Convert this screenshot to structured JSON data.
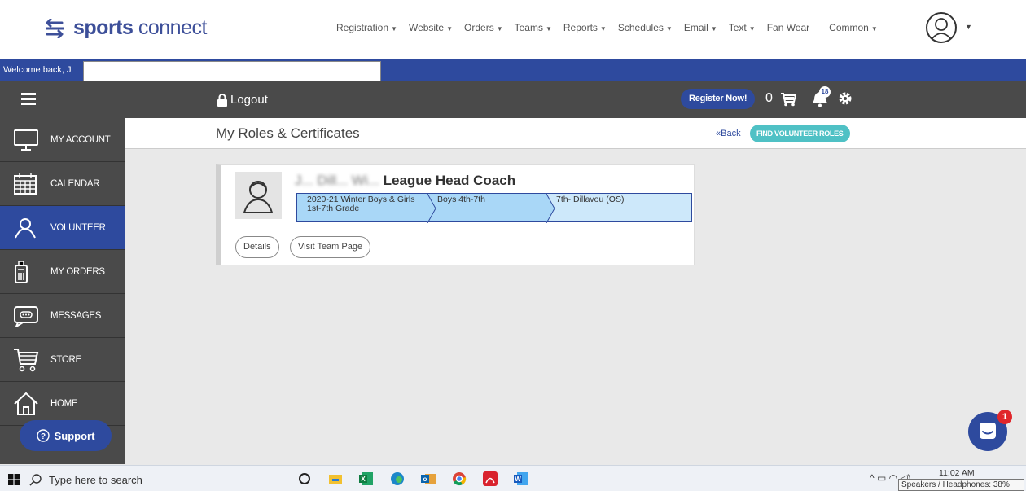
{
  "brand": {
    "bold": "sports",
    "thin": " connect"
  },
  "nav": {
    "items": [
      {
        "label": "Registration",
        "caret": true
      },
      {
        "label": "Website",
        "caret": true
      },
      {
        "label": "Orders",
        "caret": true
      },
      {
        "label": "Teams",
        "caret": true
      },
      {
        "label": "Reports",
        "caret": true
      },
      {
        "label": "Schedules",
        "caret": true
      },
      {
        "label": "Email",
        "caret": true
      },
      {
        "label": "Text",
        "caret": true
      },
      {
        "label": "Fan Wear",
        "caret": false
      },
      {
        "label": "Common",
        "caret": true
      }
    ]
  },
  "welcome": {
    "text": "Welcome back, J"
  },
  "toolbar": {
    "logout": "Logout",
    "register": "Register Now!",
    "cart_count": "0",
    "bell_count": "18"
  },
  "sidebar": {
    "items": [
      {
        "label": "MY ACCOUNT",
        "icon": "monitor-icon"
      },
      {
        "label": "CALENDAR",
        "icon": "calendar-icon"
      },
      {
        "label": "VOLUNTEER",
        "icon": "volunteer-icon"
      },
      {
        "label": "MY ORDERS",
        "icon": "orders-icon"
      },
      {
        "label": "MESSAGES",
        "icon": "messages-icon"
      },
      {
        "label": "STORE",
        "icon": "cart-icon"
      },
      {
        "label": "HOME",
        "icon": "home-icon"
      }
    ],
    "support": "Support"
  },
  "page": {
    "title": "My Roles & Certificates",
    "back": "Back",
    "find_roles": "FIND VOLUNTEER ROLES"
  },
  "card": {
    "title_obscured": "J... Dill... Wi...",
    "title": "League Head Coach",
    "crumbs": [
      "2020-21 Winter Boys & Girls 1st-7th Grade",
      "Boys 4th-7th",
      "7th- Dillavou (OS)"
    ],
    "details": "Details",
    "team_page": "Visit Team Page"
  },
  "intercom": {
    "badge": "1"
  },
  "taskbar": {
    "search": "Type here to search",
    "time": "11:02 AM",
    "tooltip": "Speakers / Headphones: 38%"
  },
  "colors": {
    "brand_blue": "#2e4a9e",
    "teal": "#4fc1c5",
    "sidebar": "#4a4a4a"
  }
}
